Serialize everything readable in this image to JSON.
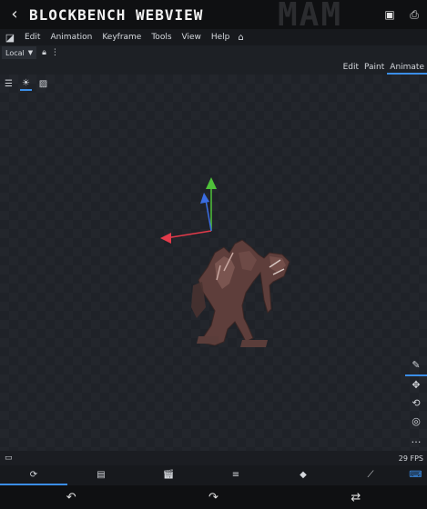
{
  "titlebar": {
    "title": "BLOCKBENCH WEBVIEW",
    "watermark": "MAM",
    "icons": [
      "chevron-left-icon",
      "window-icon",
      "save-icon"
    ]
  },
  "menubar": {
    "items": [
      {
        "label": "Edit"
      },
      {
        "label": "Animation"
      },
      {
        "label": "Keyframe"
      },
      {
        "label": "Tools"
      },
      {
        "label": "View"
      },
      {
        "label": "Help"
      }
    ]
  },
  "toolrow": {
    "space_select": "Local"
  },
  "modes": [
    {
      "label": "Edit",
      "active": false
    },
    {
      "label": "Paint",
      "active": false
    },
    {
      "label": "Animate",
      "active": true
    }
  ],
  "status": {
    "fps": "29 FPS"
  },
  "colors": {
    "accent": "#3b8ee8",
    "axis_x": "#e23a4a",
    "axis_y": "#4fc13a",
    "axis_z": "#3a6de2",
    "model": "#6e4a44"
  }
}
